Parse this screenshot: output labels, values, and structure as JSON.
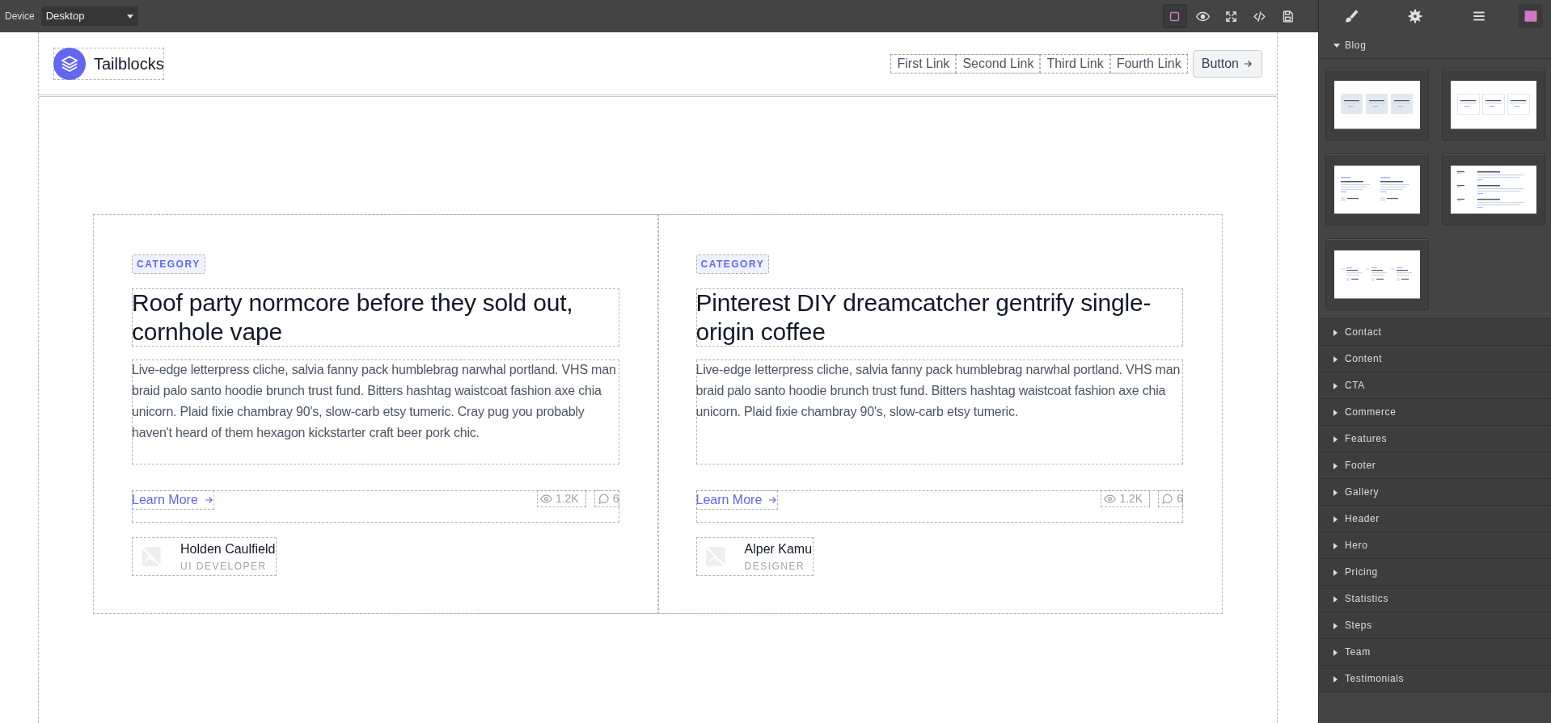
{
  "topbar": {
    "device_label": "Device",
    "device": "Desktop",
    "tools": [
      {
        "selected": true
      },
      {
        "selected": false
      },
      {
        "selected": false
      },
      {
        "selected": false
      },
      {
        "selected": false
      }
    ],
    "panel_tabs": [
      {
        "selected": false
      },
      {
        "selected": false
      },
      {
        "selected": false
      },
      {
        "selected": true
      }
    ]
  },
  "site_header": {
    "brand": "Tailblocks",
    "links": [
      "First Link",
      "Second Link",
      "Third Link",
      "Fourth Link"
    ],
    "button": "Button"
  },
  "posts": [
    {
      "category": "CATEGORY",
      "title": "Roof party normcore before they sold out, cornhole vape",
      "excerpt": "Live-edge letterpress cliche, salvia fanny pack humblebrag narwhal portland. VHS man braid palo santo hoodie brunch trust fund. Bitters hashtag waistcoat fashion axe chia unicorn. Plaid fixie chambray 90's, slow-carb etsy tumeric. Cray pug you probably haven't heard of them hexagon kickstarter craft beer pork chic.",
      "link": "Learn More",
      "views": "1.2K",
      "comments": "6",
      "author": "Holden Caulfield",
      "role": "UI DEVELOPER"
    },
    {
      "category": "CATEGORY",
      "title": "Pinterest DIY dreamcatcher gentrify single-origin coffee",
      "excerpt": "Live-edge letterpress cliche, salvia fanny pack humblebrag narwhal portland. VHS man braid palo santo hoodie brunch trust fund. Bitters hashtag waistcoat fashion axe chia unicorn. Plaid fixie chambray 90's, slow-carb etsy tumeric.",
      "link": "Learn More",
      "views": "1.2K",
      "comments": "6",
      "author": "Alper Kamu",
      "role": "DESIGNER"
    }
  ],
  "block_categories": [
    {
      "label": "Blog",
      "expanded": true,
      "blocks": [
        {
          "kind": "gray-cards"
        },
        {
          "kind": "image-cards"
        },
        {
          "kind": "two-columns"
        },
        {
          "kind": "list"
        },
        {
          "kind": "three-columns"
        }
      ]
    },
    {
      "label": "Contact",
      "expanded": false
    },
    {
      "label": "Content",
      "expanded": false
    },
    {
      "label": "CTA",
      "expanded": false
    },
    {
      "label": "Commerce",
      "expanded": false
    },
    {
      "label": "Features",
      "expanded": false
    },
    {
      "label": "Footer",
      "expanded": false
    },
    {
      "label": "Gallery",
      "expanded": false
    },
    {
      "label": "Header",
      "expanded": false
    },
    {
      "label": "Hero",
      "expanded": false
    },
    {
      "label": "Pricing",
      "expanded": false
    },
    {
      "label": "Statistics",
      "expanded": false
    },
    {
      "label": "Steps",
      "expanded": false
    },
    {
      "label": "Team",
      "expanded": false
    },
    {
      "label": "Testimonials",
      "expanded": false
    }
  ]
}
